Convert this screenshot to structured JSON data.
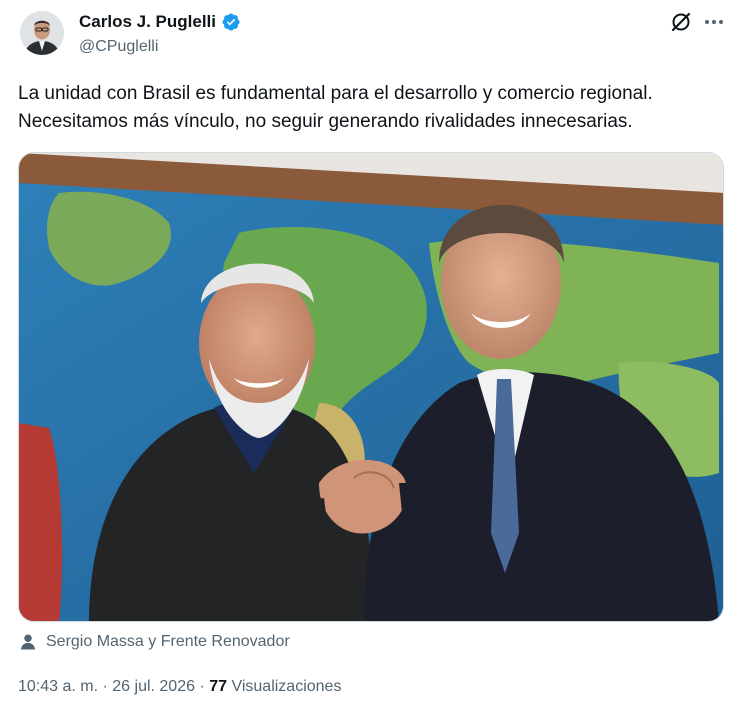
{
  "author": {
    "display_name": "Carlos J. Puglelli",
    "handle": "@CPuglelli",
    "verified": true,
    "avatar_icon": "profile-avatar"
  },
  "icons": {
    "grok": "grok-icon",
    "more": "more-options-icon",
    "person": "person-icon",
    "verified": "verified-badge-icon"
  },
  "tweet": {
    "lines": [
      "La unidad con Brasil es fundamental para el desarrollo y comercio regional.",
      "Necesitamos más vínculo, no seguir generando rivalidades innecesarias."
    ]
  },
  "media": {
    "tagged": "Sergio Massa y Frente Renovador"
  },
  "meta": {
    "time": "10:43 a. m.",
    "separator1": " · ",
    "date": "26 jul. 2026",
    "separator2": " · ",
    "views_count": "77",
    "views_label": " Visualizaciones"
  },
  "colors": {
    "text": "#0f1419",
    "secondary": "#536471",
    "verified": "#1d9bf0"
  }
}
